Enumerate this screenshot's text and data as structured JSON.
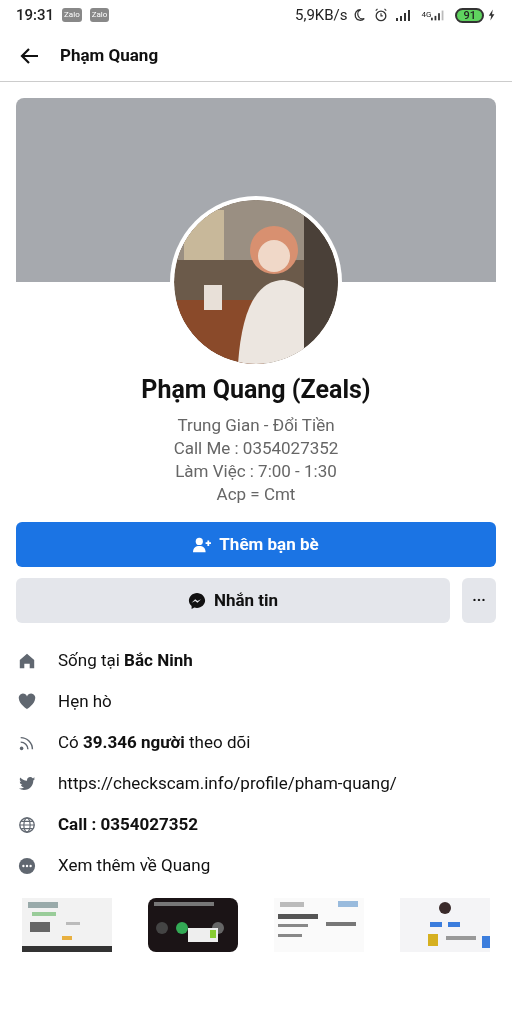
{
  "status_bar": {
    "time": "19:31",
    "notifications": [
      "Zalo",
      "Zalo"
    ],
    "speed": "5,9KB/s",
    "network": "4G",
    "battery": "91"
  },
  "header": {
    "title": "Phạm Quang"
  },
  "profile": {
    "name": "Phạm Quang (Zeals)",
    "bio": [
      "Trung Gian - Đổi Tiền",
      "Call Me : 0354027352",
      "Làm Việc : 7:00 - 1:30",
      "Acp = Cmt"
    ]
  },
  "buttons": {
    "add_friend": "Thêm bạn bè",
    "message": "Nhắn tin",
    "more": "···"
  },
  "info": [
    {
      "kind": "home",
      "text": "Sống tại **Bắc Ninh**"
    },
    {
      "kind": "heart",
      "text": "Hẹn hò"
    },
    {
      "kind": "feed",
      "text": "Có **39.346 người** theo dõi"
    },
    {
      "kind": "bird",
      "text": "https://checkscam.info/profile/pham-quang/"
    },
    {
      "kind": "globe",
      "text": "**Call : 0354027352**"
    },
    {
      "kind": "more",
      "text": "Xem thêm về Quang"
    }
  ]
}
